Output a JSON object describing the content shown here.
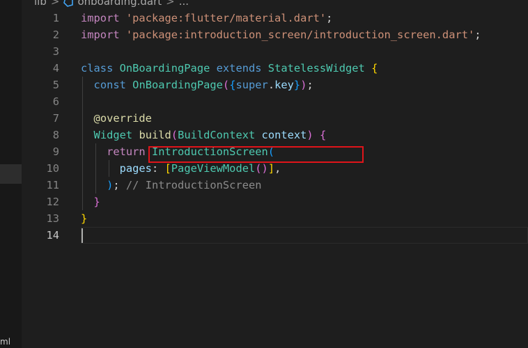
{
  "breadcrumb": {
    "folder": "lib",
    "separator": ">",
    "file": "onboarding.dart",
    "ellipsis": "..."
  },
  "activity_bar": {
    "bottom_label": "ml"
  },
  "colors": {
    "background": "#1e1e1e",
    "keyword": "#569cd6",
    "control_keyword": "#c586c0",
    "string": "#ce9178",
    "type": "#4ec9b0",
    "function": "#dcdcaa",
    "variable": "#9cdcfe",
    "comment": "#8b8b8b",
    "highlight_box": "#e0141a"
  },
  "editor": {
    "active_line": 14,
    "lines": [
      {
        "num": "1",
        "tokens": [
          {
            "t": "import",
            "c": "kw-purple"
          },
          {
            "t": " "
          },
          {
            "t": "'package:flutter/material.dart'",
            "c": "str"
          },
          {
            "t": ";"
          }
        ]
      },
      {
        "num": "2",
        "tokens": [
          {
            "t": "import",
            "c": "kw-purple"
          },
          {
            "t": " "
          },
          {
            "t": "'package:introduction_screen/introduction_screen.dart'",
            "c": "str"
          },
          {
            "t": ";"
          }
        ]
      },
      {
        "num": "3",
        "tokens": []
      },
      {
        "num": "4",
        "tokens": [
          {
            "t": "class",
            "c": "kw-blue"
          },
          {
            "t": " "
          },
          {
            "t": "OnBoardingPage",
            "c": "cls"
          },
          {
            "t": " "
          },
          {
            "t": "extends",
            "c": "kw-blue"
          },
          {
            "t": " "
          },
          {
            "t": "StatelessWidget",
            "c": "cls"
          },
          {
            "t": " "
          },
          {
            "t": "{",
            "c": "b1"
          }
        ]
      },
      {
        "num": "5",
        "tokens": [
          {
            "t": "  "
          },
          {
            "t": "const",
            "c": "kw-blue"
          },
          {
            "t": " "
          },
          {
            "t": "OnBoardingPage",
            "c": "cls"
          },
          {
            "t": "(",
            "c": "b2"
          },
          {
            "t": "{",
            "c": "b3"
          },
          {
            "t": "super",
            "c": "kw-blue"
          },
          {
            "t": "."
          },
          {
            "t": "key",
            "c": "var"
          },
          {
            "t": "}",
            "c": "b3"
          },
          {
            "t": ")",
            "c": "b2"
          },
          {
            "t": ";"
          }
        ]
      },
      {
        "num": "6",
        "tokens": []
      },
      {
        "num": "7",
        "tokens": [
          {
            "t": "  "
          },
          {
            "t": "@override",
            "c": "fn"
          }
        ]
      },
      {
        "num": "8",
        "tokens": [
          {
            "t": "  "
          },
          {
            "t": "Widget",
            "c": "cls"
          },
          {
            "t": " "
          },
          {
            "t": "build",
            "c": "fn"
          },
          {
            "t": "(",
            "c": "b2"
          },
          {
            "t": "BuildContext",
            "c": "cls"
          },
          {
            "t": " "
          },
          {
            "t": "context",
            "c": "var"
          },
          {
            "t": ")",
            "c": "b2"
          },
          {
            "t": " "
          },
          {
            "t": "{",
            "c": "b2"
          }
        ]
      },
      {
        "num": "9",
        "tokens": [
          {
            "t": "    "
          },
          {
            "t": "return",
            "c": "kw-purple"
          },
          {
            "t": " "
          },
          {
            "t": "IntroductionScreen",
            "c": "cls"
          },
          {
            "t": "(",
            "c": "b3"
          }
        ]
      },
      {
        "num": "10",
        "tokens": [
          {
            "t": "      "
          },
          {
            "t": "pages",
            "c": "var"
          },
          {
            "t": ": "
          },
          {
            "t": "[",
            "c": "b1"
          },
          {
            "t": "PageViewModel",
            "c": "cls"
          },
          {
            "t": "(",
            "c": "b2"
          },
          {
            "t": ")",
            "c": "b2"
          },
          {
            "t": "]",
            "c": "b1"
          },
          {
            "t": ","
          }
        ]
      },
      {
        "num": "11",
        "tokens": [
          {
            "t": "    "
          },
          {
            "t": ")",
            "c": "b3"
          },
          {
            "t": "; "
          },
          {
            "t": "// IntroductionScreen",
            "c": "cmt"
          }
        ]
      },
      {
        "num": "12",
        "tokens": [
          {
            "t": "  "
          },
          {
            "t": "}",
            "c": "b2"
          }
        ]
      },
      {
        "num": "13",
        "tokens": [
          {
            "t": "}",
            "c": "b1"
          }
        ]
      },
      {
        "num": "14",
        "tokens": []
      }
    ]
  }
}
